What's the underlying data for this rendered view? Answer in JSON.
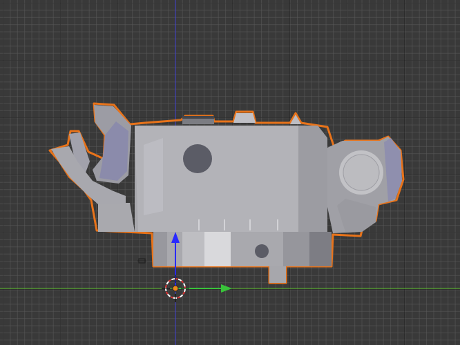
{
  "viewport": {
    "background_color": "#393939",
    "grid_minor_color": "#2f2f2f",
    "grid_major_color": "#262626",
    "x_axis_color": "#5cbf2a",
    "y_axis_color": "#3a3aff",
    "selection_outline_color": "#e8731a",
    "object_color": "#a9a9ad",
    "accent_color": "#8c8ca8"
  },
  "icons": {
    "cursor": "3d-cursor-icon",
    "gizmo_x": "arrow-right-icon",
    "gizmo_y": "arrow-up-icon",
    "lamp": "lamp-icon"
  }
}
